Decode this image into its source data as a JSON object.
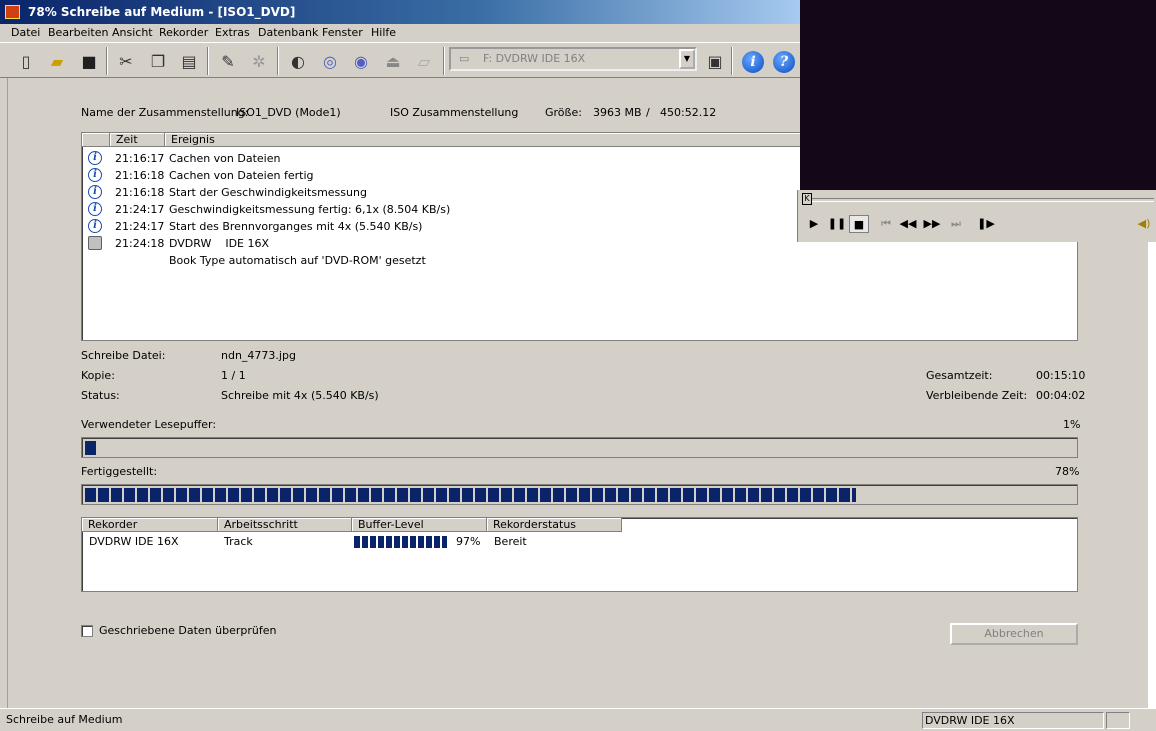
{
  "window": {
    "title": "78% Schreibe auf Medium - [ISO1_DVD]"
  },
  "menu": [
    "Datei",
    "Bearbeiten",
    "Ansicht",
    "Rekorder",
    "Extras",
    "Datenbank",
    "Fenster",
    "Hilfe"
  ],
  "toolbar": {
    "icons": [
      "new-icon",
      "open-icon",
      "save-icon",
      "cut-icon",
      "copy-icon",
      "paste-icon",
      "compile-icon",
      "burn-icon",
      "drive-icon",
      "copy-disc-icon",
      "disc-info-icon",
      "eject-icon",
      "folder-icon"
    ],
    "drive": "F: DVDRW    IDE 16X",
    "info_label": "i",
    "help_label": "?"
  },
  "compilation": {
    "name_label": "Name der Zusammenstellung:",
    "name_value": "ISO1_DVD (Mode1)",
    "type": "ISO Zusammenstellung",
    "size_label": "Größe:",
    "size_value": "3963 MB",
    "slash": "/",
    "duration": "450:52.12"
  },
  "log": {
    "col_time": "Zeit",
    "col_event": "Ereignis",
    "rows": [
      {
        "time": "21:16:17",
        "event": "Cachen von Dateien",
        "icon": "info-icon"
      },
      {
        "time": "21:16:18",
        "event": "Cachen von Dateien fertig",
        "icon": "info-icon"
      },
      {
        "time": "21:16:18",
        "event": "Start der Geschwindigkeitsmessung",
        "icon": "info-icon"
      },
      {
        "time": "21:24:17",
        "event": "Geschwindigkeitsmessung fertig: 6,1x (8.504 KB/s)",
        "icon": "info-icon"
      },
      {
        "time": "21:24:17",
        "event": "Start des Brennvorganges mit 4x (5.540 KB/s)",
        "icon": "info-icon"
      },
      {
        "time": "21:24:18",
        "event": "DVDRW    IDE 16X",
        "icon": "drive-icon"
      },
      {
        "time": "",
        "event": "Book Type automatisch auf 'DVD-ROM' gesetzt",
        "icon": ""
      }
    ]
  },
  "progress": {
    "file_label": "Schreibe Datei:",
    "file_value": "ndn_4773.jpg",
    "copy_label": "Kopie:",
    "copy_value": "1 / 1",
    "status_label": "Status:",
    "status_value": "Schreibe mit 4x (5.540 KB/s)",
    "total_label": "Gesamtzeit:",
    "total_value": "00:15:10",
    "remaining_label": "Verbleibende Zeit:",
    "remaining_value": "00:04:02",
    "buffer_label": "Verwendeter Lesepuffer:",
    "buffer_pct": "1%",
    "buffer_fraction": 0.01,
    "done_label": "Fertiggestellt:",
    "done_pct": "78%",
    "done_fraction": 0.78
  },
  "recorder_table": {
    "headers": [
      "Rekorder",
      "Arbeitsschritt",
      "Buffer-Level",
      "Rekorderstatus"
    ],
    "row": {
      "recorder": "DVDRW IDE 16X",
      "step": "Track",
      "buffer": "97%",
      "buffer_fraction": 0.97,
      "status": "Bereit"
    }
  },
  "verify_label": "Geschriebene Daten überprüfen",
  "cancel_label": "Abbrechen",
  "statusbar": {
    "left": "Schreibe auf Medium",
    "drive": "DVDRW    IDE 16X"
  },
  "player": {
    "seek_label": "K"
  }
}
